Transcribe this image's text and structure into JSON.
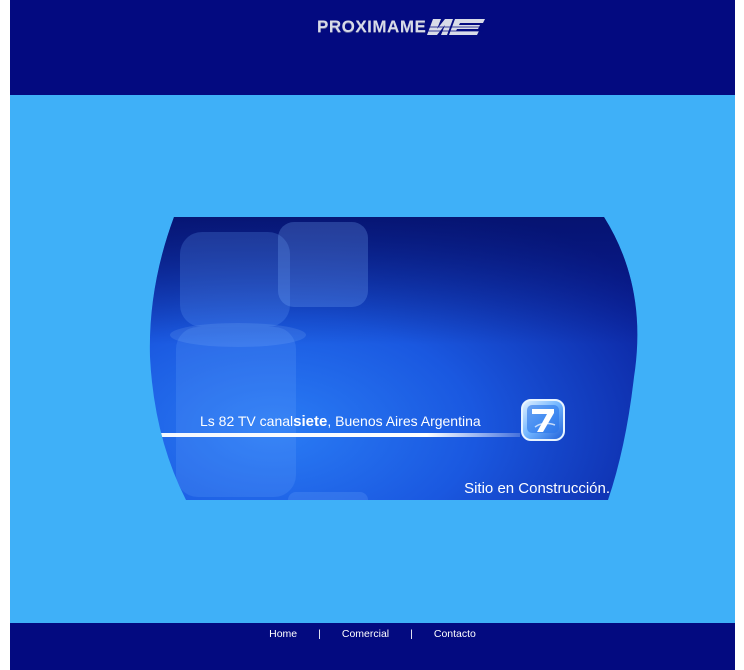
{
  "header": {
    "logo_text": "PROXIMAME",
    "logo_mark_icon": "stylized-nte-wordmark"
  },
  "banner": {
    "station_prefix": "Ls 82 TV canal",
    "station_bold": "siete",
    "station_suffix": ", Buenos Aires Argentina",
    "status_text": "Sitio en Construcción.",
    "channel_icon": "channel-7-logo-icon"
  },
  "footer": {
    "nav": [
      {
        "label": "Home"
      },
      {
        "label": "Comercial"
      },
      {
        "label": "Contacto"
      }
    ],
    "separator": "|"
  },
  "colors": {
    "header_bg": "#030a80",
    "page_bg": "#3fb0f8",
    "banner_dark": "#0a2fb8",
    "banner_light": "#1e6ff0"
  }
}
